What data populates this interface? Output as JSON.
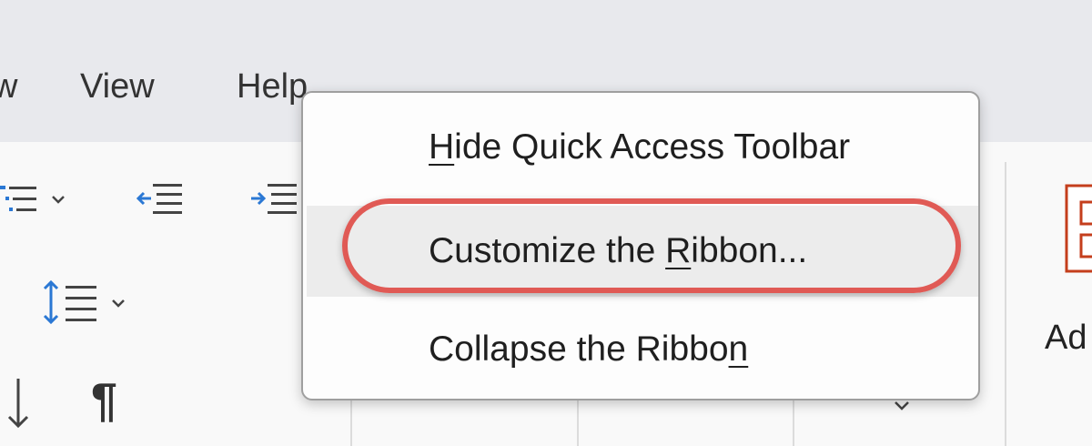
{
  "tabs": [
    {
      "label": "w"
    },
    {
      "label": "View"
    },
    {
      "label": "Help"
    }
  ],
  "context_menu": {
    "items": [
      {
        "before": "",
        "key": "H",
        "after": "ide Quick Access Toolbar"
      },
      {
        "before": "Customize the ",
        "key": "R",
        "after": "ibbon..."
      },
      {
        "before": "Collapse the Ribbo",
        "key": "n",
        "after": ""
      }
    ],
    "hovered_index": 1
  },
  "ribbon": {
    "pilcrow": "¶",
    "partial_label": "Ad"
  },
  "colors": {
    "highlight": "#e05a55",
    "icon_blue": "#2b78d4",
    "icon_red": "#c43e1c"
  },
  "icons": [
    "multilevel-list-icon",
    "decrease-indent-icon",
    "increase-indent-icon",
    "line-spacing-icon",
    "sort-icon",
    "show-formatting-marks-icon",
    "add-in-icon"
  ]
}
